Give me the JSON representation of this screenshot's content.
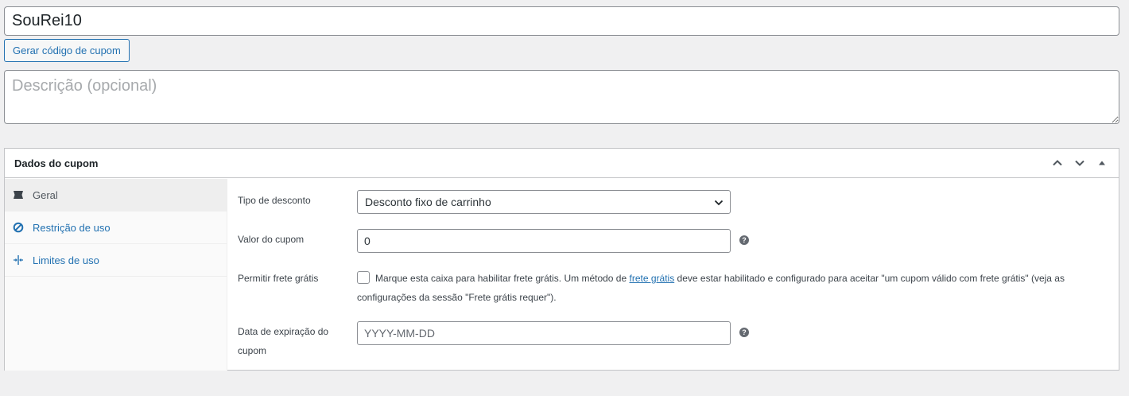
{
  "coupon": {
    "code_value": "SouRei10",
    "generate_label": "Gerar código de cupom",
    "description_placeholder": "Descrição (opcional)"
  },
  "postbox": {
    "title": "Dados do cupom",
    "header_icons": [
      "chevron-up-icon",
      "chevron-down-icon",
      "toggle-arrow-icon"
    ]
  },
  "tabs": [
    {
      "label": "Geral",
      "icon": "ticket-icon",
      "active": true
    },
    {
      "label": "Restrição de uso",
      "icon": "block-icon",
      "active": false
    },
    {
      "label": "Limites de uso",
      "icon": "limits-icon",
      "active": false
    }
  ],
  "general": {
    "discount_type_label": "Tipo de desconto",
    "discount_type_value": "Desconto fixo de carrinho",
    "amount_label": "Valor do cupom",
    "amount_value": "0",
    "free_shipping_label": "Permitir frete grátis",
    "free_shipping_text_before": "Marque esta caixa para habilitar frete grátis. Um método de ",
    "free_shipping_link": "frete grátis",
    "free_shipping_text_after": " deve estar habilitado e configurado para aceitar \"um cupom válido com frete grátis\" (veja as configurações da sessão \"Frete grátis requer\").",
    "expiry_label": "Data de expiração do cupom",
    "expiry_placeholder": "YYYY-MM-DD"
  },
  "colors": {
    "accent": "#2271b1",
    "background": "#f0f0f1",
    "border": "#c3c4c7"
  }
}
